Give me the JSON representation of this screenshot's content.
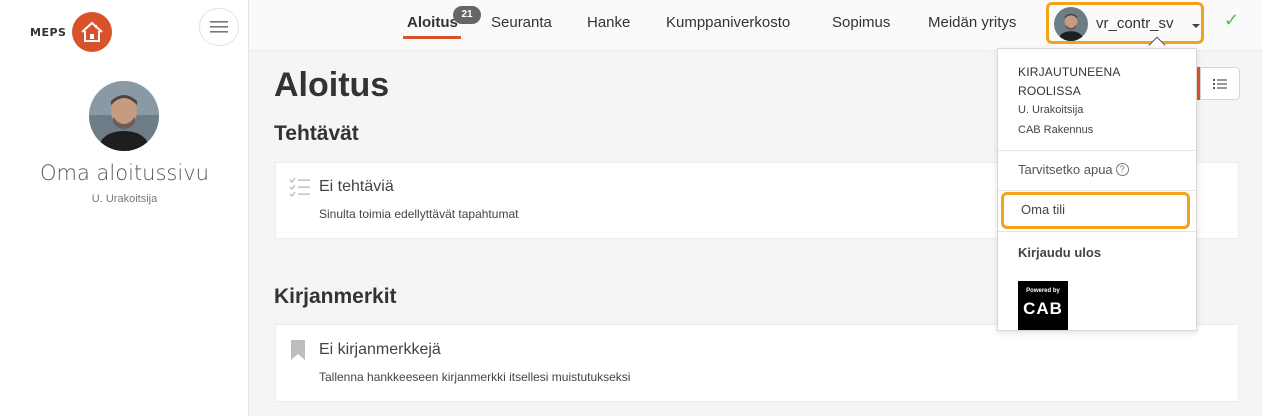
{
  "brand": {
    "name": "MEPS",
    "accent": "#d9532a",
    "highlight": "#f0a31b"
  },
  "sidebar": {
    "title": "Oma aloitussivu",
    "subtitle": "U. Urakoitsija",
    "menu_icon": "hamburger-icon"
  },
  "nav": {
    "items": [
      {
        "label": "Aloitus",
        "active": true
      },
      {
        "label": "Seuranta"
      },
      {
        "label": "Hanke"
      },
      {
        "label": "Kumppaniverkosto"
      },
      {
        "label": "Sopimus"
      },
      {
        "label": "Meidän yritys"
      }
    ],
    "badge": "21",
    "user": "vr_contr_sv"
  },
  "main": {
    "title": "Aloitus",
    "tasks": {
      "heading": "Tehtävät",
      "empty_title": "Ei tehtäviä",
      "empty_sub": "Sinulta toimia edellyttävät tapahtumat"
    },
    "bookmarks": {
      "heading": "Kirjanmerkit",
      "empty_title": "Ei kirjanmerkkejä",
      "empty_sub": "Tallenna hankkeeseen kirjanmerkki itsellesi muistutukseksi"
    }
  },
  "dropdown": {
    "role_title": "KIRJAUTUNEENA ROOLISSA",
    "role_name": "U. Urakoitsija",
    "company": "CAB Rakennus",
    "help": "Tarvitsetko apua",
    "account": "Oma tili",
    "logout": "Kirjaudu ulos",
    "cab_small": "Powered by",
    "cab_big": "CAB"
  }
}
